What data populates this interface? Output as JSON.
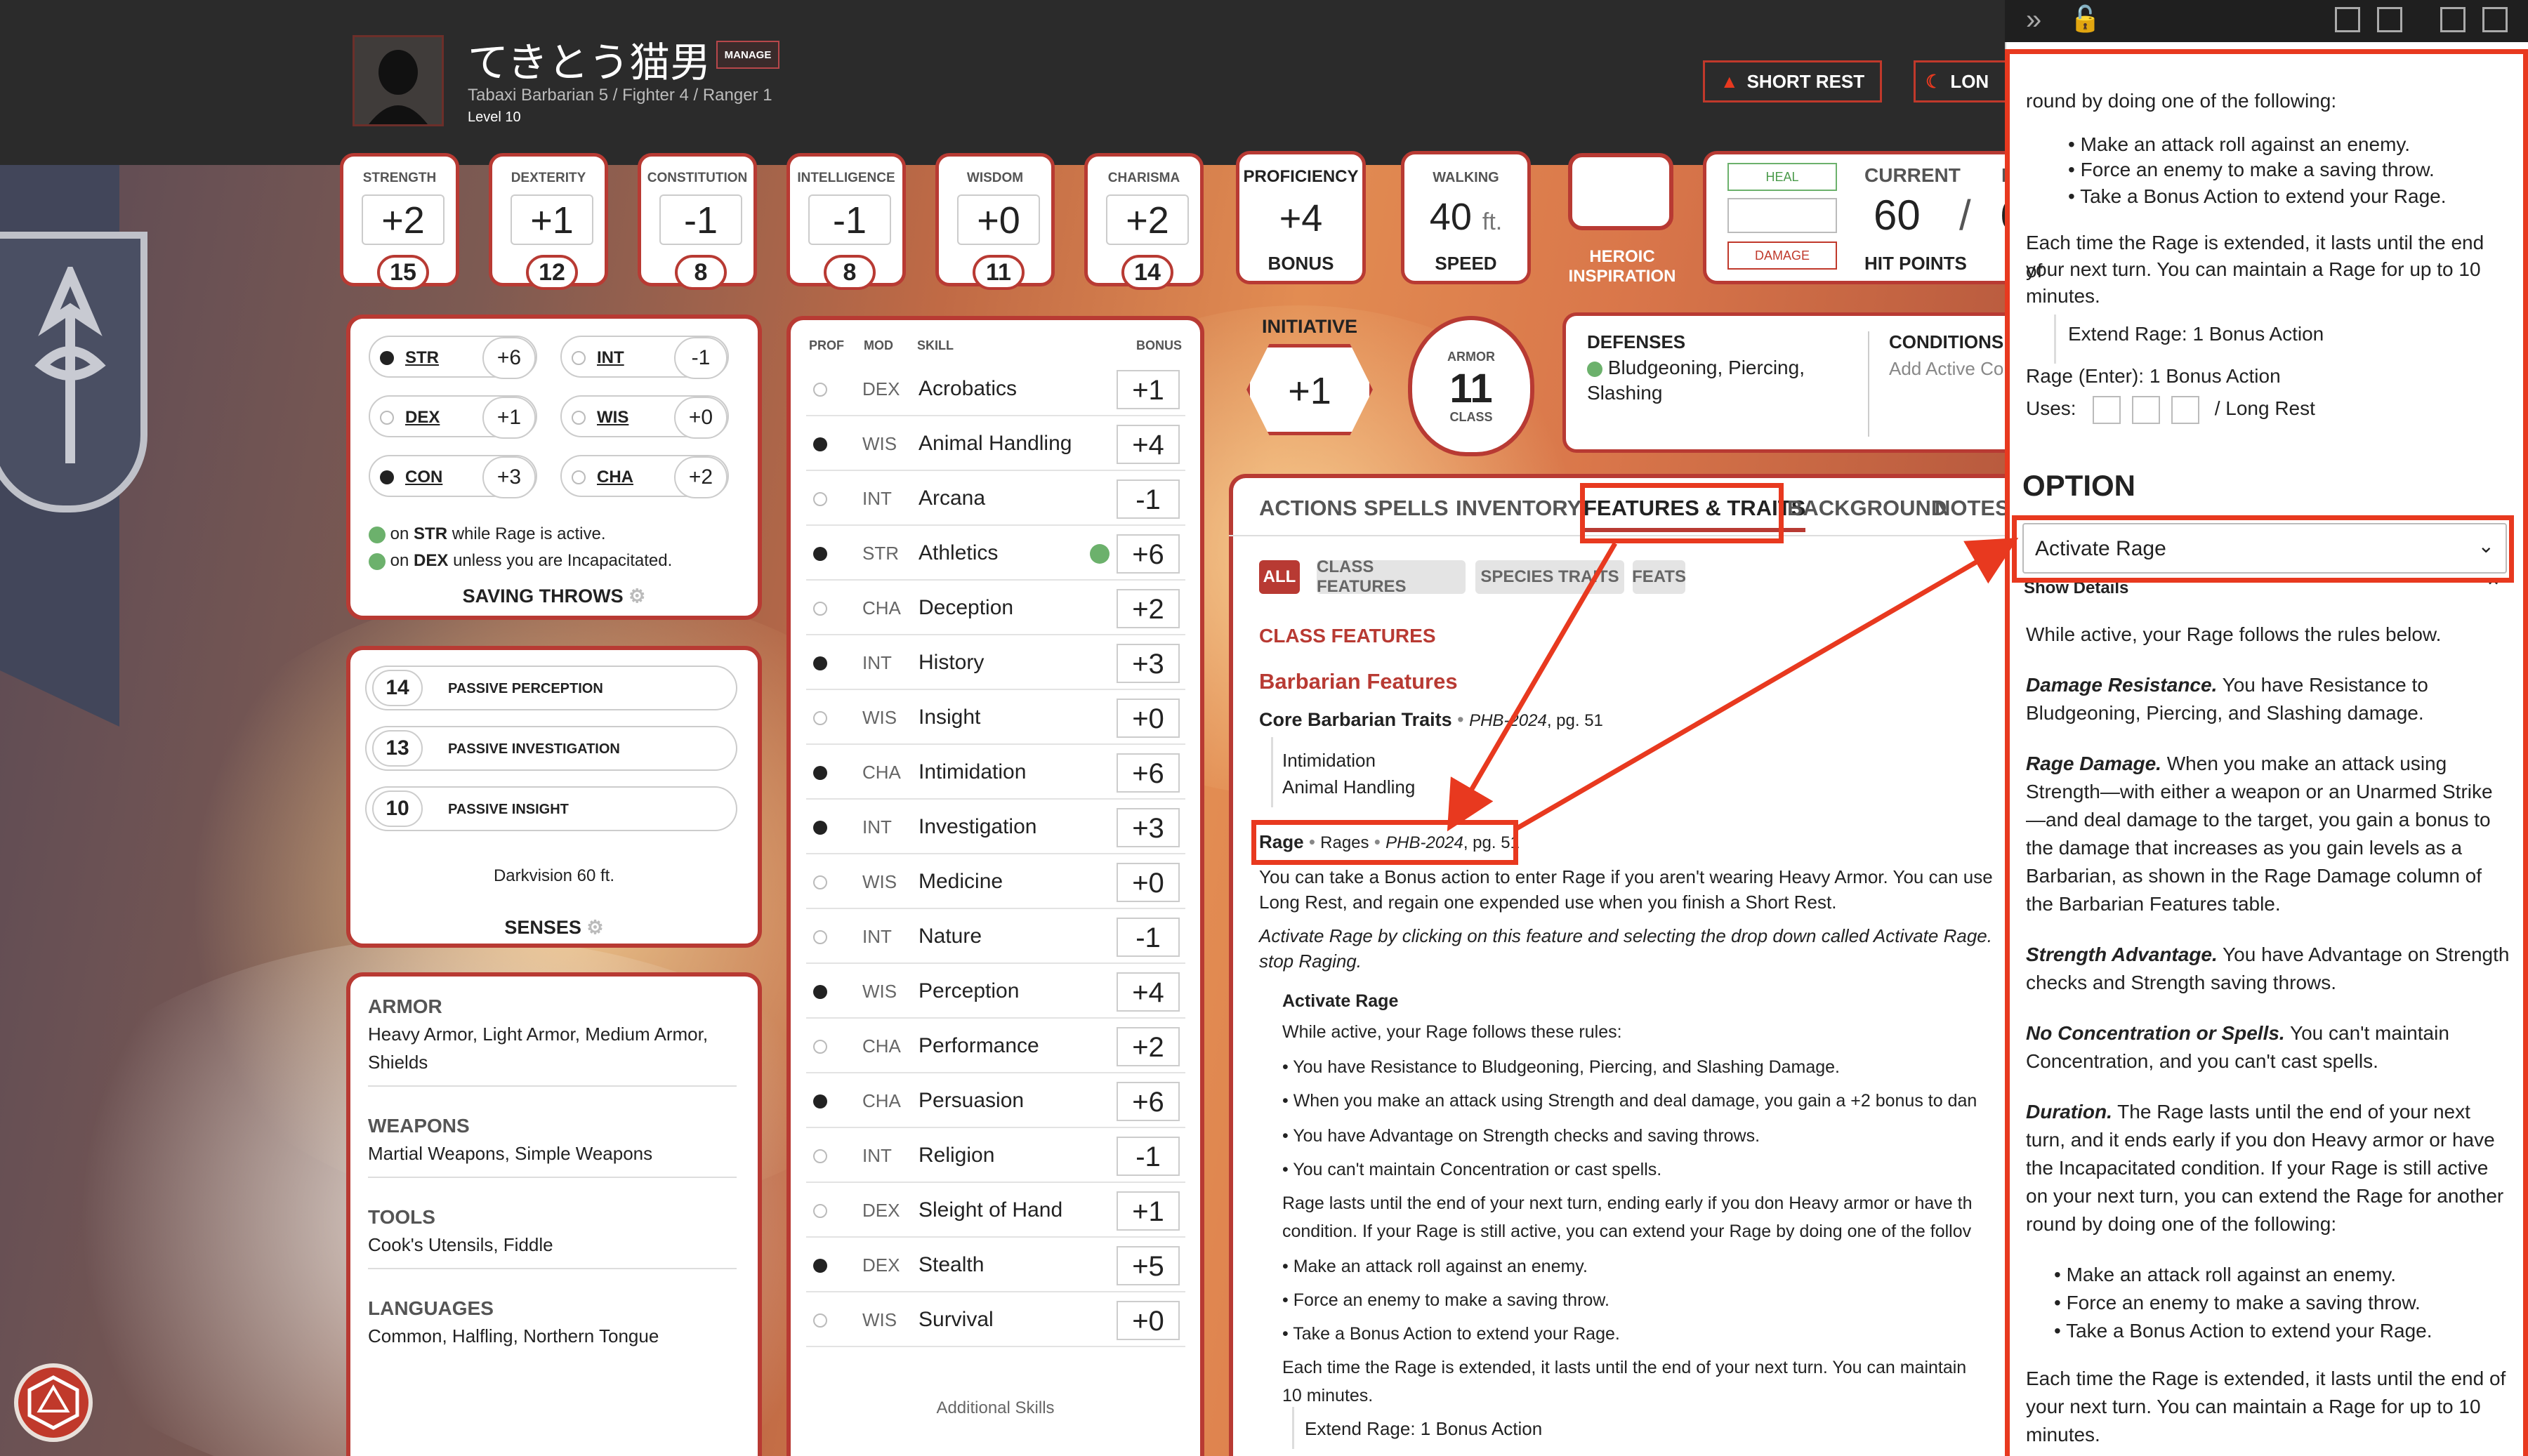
{
  "character": {
    "name": "てきとう猫男",
    "manage_label": "MANAGE",
    "subline": "Tabaxi  Barbarian 5 / Fighter 4 / Ranger 1",
    "level": "Level 10",
    "short_rest": "SHORT REST",
    "long_rest": "LON"
  },
  "abilities": [
    {
      "label": "STRENGTH",
      "mod": "+2",
      "score": "15"
    },
    {
      "label": "DEXTERITY",
      "mod": "+1",
      "score": "12"
    },
    {
      "label": "CONSTITUTION",
      "mod": "-1",
      "score": "8"
    },
    {
      "label": "INTELLIGENCE",
      "mod": "-1",
      "score": "8"
    },
    {
      "label": "WISDOM",
      "mod": "+0",
      "score": "11"
    },
    {
      "label": "CHARISMA",
      "mod": "+2",
      "score": "14"
    }
  ],
  "proficiency": {
    "label": "PROFICIENCY",
    "value": "+4",
    "sub": "BONUS"
  },
  "speed": {
    "label": "WALKING",
    "value": "40",
    "unit": "ft.",
    "sub": "SPEED"
  },
  "inspiration": {
    "line1": "HEROIC",
    "line2": "INSPIRATION"
  },
  "hp": {
    "heal": "HEAL",
    "damage": "DAMAGE",
    "current_label": "CURRENT",
    "current": "60",
    "slash": "/",
    "max_partial": "6",
    "max_label_partial": "M",
    "sub": "HIT POINTS"
  },
  "initiative": {
    "label": "INITIATIVE",
    "value": "+1"
  },
  "armor": {
    "label_top": "ARMOR",
    "value": "11",
    "label_bottom": "CLASS"
  },
  "defenses": {
    "title": "DEFENSES",
    "text1": "Bludgeoning, Piercing,",
    "text2": "Slashing"
  },
  "conditions": {
    "title": "CONDITIONS",
    "text": "Add Active Co"
  },
  "saves": [
    {
      "name": "STR",
      "bonus": "+6",
      "prof": true
    },
    {
      "name": "INT",
      "bonus": "-1",
      "prof": false
    },
    {
      "name": "DEX",
      "bonus": "+1",
      "prof": false
    },
    {
      "name": "WIS",
      "bonus": "+0",
      "prof": false
    },
    {
      "name": "CON",
      "bonus": "+3",
      "prof": true
    },
    {
      "name": "CHA",
      "bonus": "+2",
      "prof": false
    }
  ],
  "save_notes": [
    {
      "pre": "on ",
      "bold": "STR",
      "post": " while Rage is active."
    },
    {
      "pre": "on ",
      "bold": "DEX",
      "post": " unless you are Incapacitated."
    }
  ],
  "saving_throws_title": "SAVING THROWS",
  "senses": [
    {
      "value": "14",
      "name": "PASSIVE PERCEPTION"
    },
    {
      "value": "13",
      "name": "PASSIVE INVESTIGATION"
    },
    {
      "value": "10",
      "name": "PASSIVE INSIGHT"
    }
  ],
  "darkvision": "Darkvision 60 ft.",
  "senses_title": "SENSES",
  "proficiencies": [
    {
      "title": "ARMOR",
      "lines": [
        "Heavy Armor, Light Armor, Medium Armor,",
        "Shields"
      ]
    },
    {
      "title": "WEAPONS",
      "lines": [
        "Martial Weapons, Simple Weapons"
      ]
    },
    {
      "title": "TOOLS",
      "lines": [
        "Cook's Utensils, Fiddle"
      ]
    },
    {
      "title": "LANGUAGES",
      "lines": [
        "Common, Halfling, Northern Tongue"
      ]
    }
  ],
  "skills_head": {
    "prof": "PROF",
    "mod": "MOD",
    "skill": "SKILL",
    "bonus": "BONUS"
  },
  "skills": [
    {
      "prof": false,
      "mod": "DEX",
      "name": "Acrobatics",
      "bonus": "+1"
    },
    {
      "prof": true,
      "mod": "WIS",
      "name": "Animal Handling",
      "bonus": "+4"
    },
    {
      "prof": false,
      "mod": "INT",
      "name": "Arcana",
      "bonus": "-1"
    },
    {
      "prof": true,
      "mod": "STR",
      "name": "Athletics",
      "bonus": "+6",
      "adv": true
    },
    {
      "prof": false,
      "mod": "CHA",
      "name": "Deception",
      "bonus": "+2"
    },
    {
      "prof": true,
      "mod": "INT",
      "name": "History",
      "bonus": "+3"
    },
    {
      "prof": false,
      "mod": "WIS",
      "name": "Insight",
      "bonus": "+0"
    },
    {
      "prof": true,
      "mod": "CHA",
      "name": "Intimidation",
      "bonus": "+6"
    },
    {
      "prof": true,
      "mod": "INT",
      "name": "Investigation",
      "bonus": "+3"
    },
    {
      "prof": false,
      "mod": "WIS",
      "name": "Medicine",
      "bonus": "+0"
    },
    {
      "prof": false,
      "mod": "INT",
      "name": "Nature",
      "bonus": "-1"
    },
    {
      "prof": true,
      "mod": "WIS",
      "name": "Perception",
      "bonus": "+4"
    },
    {
      "prof": false,
      "mod": "CHA",
      "name": "Performance",
      "bonus": "+2"
    },
    {
      "prof": true,
      "mod": "CHA",
      "name": "Persuasion",
      "bonus": "+6"
    },
    {
      "prof": false,
      "mod": "INT",
      "name": "Religion",
      "bonus": "-1"
    },
    {
      "prof": false,
      "mod": "DEX",
      "name": "Sleight of Hand",
      "bonus": "+1"
    },
    {
      "prof": true,
      "mod": "DEX",
      "name": "Stealth",
      "bonus": "+5"
    },
    {
      "prof": false,
      "mod": "WIS",
      "name": "Survival",
      "bonus": "+0"
    }
  ],
  "additional_skills": "Additional Skills",
  "tabs": [
    "ACTIONS",
    "SPELLS",
    "INVENTORY",
    "FEATURES & TRAITS",
    "BACKGROUND",
    "NOTES"
  ],
  "filters": [
    "ALL",
    "CLASS FEATURES",
    "SPECIES TRAITS",
    "FEATS"
  ],
  "features": {
    "section": "CLASS FEATURES",
    "group": "Barbarian Features",
    "core_name": "Core Barbarian Traits",
    "core_src": "PHB-2024",
    "core_pg": ", pg. 51",
    "core_lines": [
      "Intimidation",
      "Animal Handling"
    ],
    "rage_name": "Rage",
    "rage_tag": "Rages",
    "rage_src": "PHB-2024",
    "rage_pg": ", pg. 51",
    "rage_p1": "You can take a Bonus action to enter Rage if you aren't wearing Heavy Armor. You can use",
    "rage_p2": "Long Rest, and regain one expended use when you finish a Short Rest.",
    "rage_i1": "Activate Rage by clicking on this feature and selecting the drop down called Activate Rage.",
    "rage_i2": "stop Raging.",
    "act_title": "Activate Rage",
    "act_lines": [
      "While active, your Rage follows these rules:",
      "• You have Resistance to Bludgeoning, Piercing, and Slashing Damage.",
      "• When you make an attack using Strength and deal damage, you gain a +2 bonus to dan",
      "• You have Advantage on Strength checks and saving throws.",
      "• You can't maintain Concentration or cast spells.",
      "Rage lasts until the end of your next turn, ending early if you don Heavy armor or have th",
      "condition. If your Rage is still active, you can extend your Rage by doing one of the follov",
      "• Make an attack roll against an enemy.",
      "• Force an enemy to make a saving throw.",
      "• Take a Bonus Action to extend your Rage.",
      "Each time the Rage is extended, it lasts until the end of your next turn. You can maintain",
      "10 minutes."
    ],
    "extend": "Extend Rage: 1 Bonus Action"
  },
  "overlay": {
    "top_lines": [
      "round by doing one of the following:",
      "• Make an attack roll against an enemy.",
      "• Force an enemy to make a saving throw.",
      "• Take a Bonus Action to extend your Rage.",
      "Each time the Rage is extended, it lasts until the end of",
      "your next turn. You can maintain a Rage for up to 10",
      "minutes."
    ],
    "extend": "Extend Rage: 1 Bonus Action",
    "enter": "Rage (Enter): 1 Bonus Action",
    "uses_label": "Uses:",
    "uses_reset": "/   Long Rest",
    "option_title": "OPTION",
    "option_selected": "Activate Rage",
    "show_details": "Show Details",
    "details": [
      {
        "b": "",
        "t": "While active, your Rage follows the rules below."
      },
      {
        "b": "Damage Resistance.",
        "t": " You have Resistance to Bludgeoning, Piercing, and Slashing damage."
      },
      {
        "b": "Rage Damage.",
        "t": " When you make an attack using Strength—with either a weapon or an Unarmed Strike—and deal damage to the target, you gain a bonus to the damage that increases as you gain levels as a Barbarian, as shown in the Rage Damage column of the Barbarian Features table."
      },
      {
        "b": "Strength Advantage.",
        "t": " You have Advantage on Strength checks and Strength saving throws."
      },
      {
        "b": "No Concentration or Spells.",
        "t": " You can't maintain Concentration, and you can't cast spells."
      },
      {
        "b": "Duration.",
        "t": " The Rage lasts until the end of your next turn, and it ends early if you don Heavy armor or have the Incapacitated condition. If your Rage is still active on your next turn, you can extend the Rage for another round by doing one of the following:"
      }
    ],
    "bottom_bullets": [
      "Make an attack roll against an enemy.",
      "Force an enemy to make a saving throw.",
      "Take a Bonus Action to extend your Rage."
    ],
    "bottom_para": "Each time the Rage is extended, it lasts until the end of your next turn. You can maintain a Rage for up to 10 minutes."
  },
  "colors": {
    "accent": "#b83a33",
    "annotation": "#e8391f",
    "header": "#2b2b2b"
  }
}
